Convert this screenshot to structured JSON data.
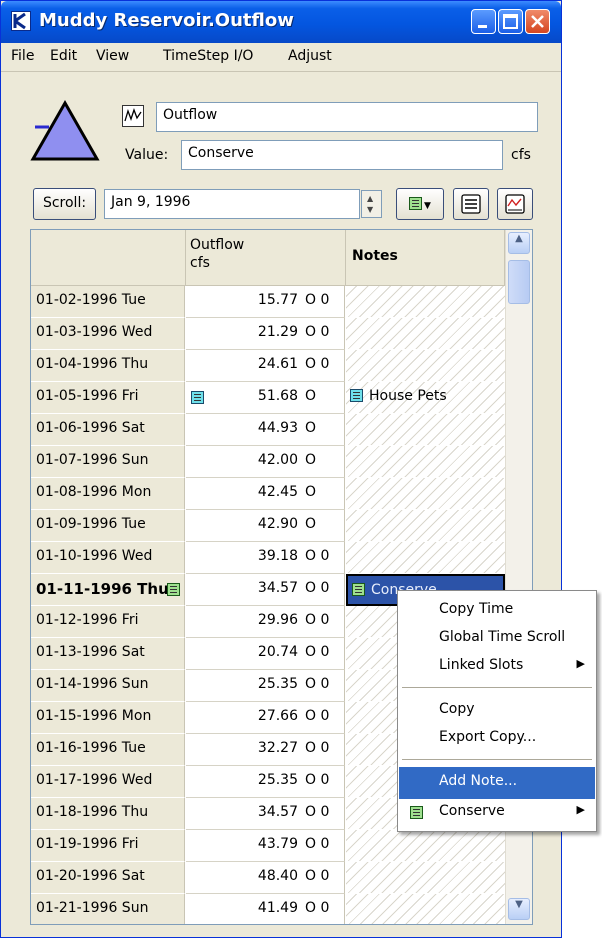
{
  "window": {
    "title": "Muddy Reservoir.Outflow"
  },
  "menu": [
    "File",
    "Edit",
    "View",
    "TimeStep I/O",
    "Adjust"
  ],
  "slot": {
    "name_value": "Outflow",
    "value_label": "Value:",
    "value_value": "Conserve",
    "units": "cfs"
  },
  "toolbar": {
    "scroll_label": "Scroll:",
    "date_value": "Jan 9, 1996"
  },
  "table": {
    "col_outflow_title": "Outflow",
    "col_outflow_units": "cfs",
    "col_notes_title": "Notes",
    "rows": [
      {
        "date": "01-02-1996 Tue",
        "value": "15.77",
        "flags": "O 0",
        "note": "",
        "value_icon": false,
        "bold": false
      },
      {
        "date": "01-03-1996 Wed",
        "value": "21.29",
        "flags": "O 0",
        "note": "",
        "value_icon": false,
        "bold": false
      },
      {
        "date": "01-04-1996 Thu",
        "value": "24.61",
        "flags": "O 0",
        "note": "",
        "value_icon": false,
        "bold": false
      },
      {
        "date": "01-05-1996 Fri",
        "value": "51.68",
        "flags": "O",
        "note": "House Pets",
        "value_icon": true,
        "bold": false
      },
      {
        "date": "01-06-1996 Sat",
        "value": "44.93",
        "flags": "O",
        "note": "",
        "value_icon": false,
        "bold": false
      },
      {
        "date": "01-07-1996 Sun",
        "value": "42.00",
        "flags": "O",
        "note": "",
        "value_icon": false,
        "bold": false
      },
      {
        "date": "01-08-1996 Mon",
        "value": "42.45",
        "flags": "O",
        "note": "",
        "value_icon": false,
        "bold": false
      },
      {
        "date": "01-09-1996 Tue",
        "value": "42.90",
        "flags": "O",
        "note": "",
        "value_icon": false,
        "bold": false
      },
      {
        "date": "01-10-1996 Wed",
        "value": "39.18",
        "flags": "O 0",
        "note": "",
        "value_icon": false,
        "bold": false
      },
      {
        "date": "01-11-1996 Thu",
        "value": "34.57",
        "flags": "O 0",
        "note": "Conserve",
        "value_icon": false,
        "bold": true
      },
      {
        "date": "01-12-1996 Fri",
        "value": "29.96",
        "flags": "O 0",
        "note": "",
        "value_icon": false,
        "bold": false
      },
      {
        "date": "01-13-1996 Sat",
        "value": "20.74",
        "flags": "O 0",
        "note": "",
        "value_icon": false,
        "bold": false
      },
      {
        "date": "01-14-1996 Sun",
        "value": "25.35",
        "flags": "O 0",
        "note": "",
        "value_icon": false,
        "bold": false
      },
      {
        "date": "01-15-1996 Mon",
        "value": "27.66",
        "flags": "O 0",
        "note": "",
        "value_icon": false,
        "bold": false
      },
      {
        "date": "01-16-1996 Tue",
        "value": "32.27",
        "flags": "O 0",
        "note": "",
        "value_icon": false,
        "bold": false
      },
      {
        "date": "01-17-1996 Wed",
        "value": "25.35",
        "flags": "O 0",
        "note": "",
        "value_icon": false,
        "bold": false
      },
      {
        "date": "01-18-1996 Thu",
        "value": "34.57",
        "flags": "O 0",
        "note": "",
        "value_icon": false,
        "bold": false
      },
      {
        "date": "01-19-1996 Fri",
        "value": "43.79",
        "flags": "O 0",
        "note": "",
        "value_icon": false,
        "bold": false
      },
      {
        "date": "01-20-1996 Sat",
        "value": "48.40",
        "flags": "O 0",
        "note": "",
        "value_icon": false,
        "bold": false
      },
      {
        "date": "01-21-1996 Sun",
        "value": "41.49",
        "flags": "O 0",
        "note": "",
        "value_icon": false,
        "bold": false
      }
    ]
  },
  "context_menu": {
    "copy_time": "Copy Time",
    "global_time_scroll": "Global Time Scroll",
    "linked_slots": "Linked Slots",
    "copy": "Copy",
    "export_copy": "Export Copy...",
    "add_note": "Add Note...",
    "conserve": "Conserve"
  },
  "colors": {
    "titlebar": "#0456e0",
    "menu_highlight": "#316ac5",
    "note_icon": "#9fe08f",
    "selected_note": "#2c53a8",
    "reservoir_fill": "#8f8ff0"
  },
  "icons": [
    "app-logo-icon",
    "minimize-icon",
    "maximize-icon",
    "close-icon",
    "reservoir-icon",
    "series-graph-icon",
    "note-icon",
    "list-icon",
    "plot-icon",
    "submenu-arrow-icon"
  ]
}
